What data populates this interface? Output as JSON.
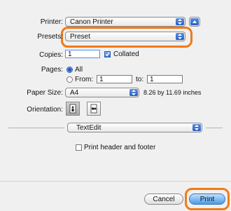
{
  "printer": {
    "label": "Printer:",
    "value": "Canon Printer"
  },
  "presets": {
    "label": "Presets:",
    "value": "Preset"
  },
  "copies": {
    "label": "Copies:",
    "value": "1",
    "collated_label": "Collated",
    "collated_checked": true
  },
  "pages": {
    "label": "Pages:",
    "all_label": "All",
    "from_label": "From:",
    "from_value": "1",
    "to_label": "to:",
    "to_value": "1",
    "selected": "All"
  },
  "paper_size": {
    "label": "Paper Size:",
    "value": "A4",
    "dimensions": "8.26 by 11.69 inches"
  },
  "orientation": {
    "label": "Orientation:",
    "selected": "portrait"
  },
  "app_menu": {
    "value": "TextEdit"
  },
  "print_header_footer": {
    "label": "Print header and footer",
    "checked": false
  },
  "buttons": {
    "cancel": "Cancel",
    "print": "Print"
  },
  "colors": {
    "highlight": "#f07a1a",
    "accent": "#2a5cc0"
  }
}
